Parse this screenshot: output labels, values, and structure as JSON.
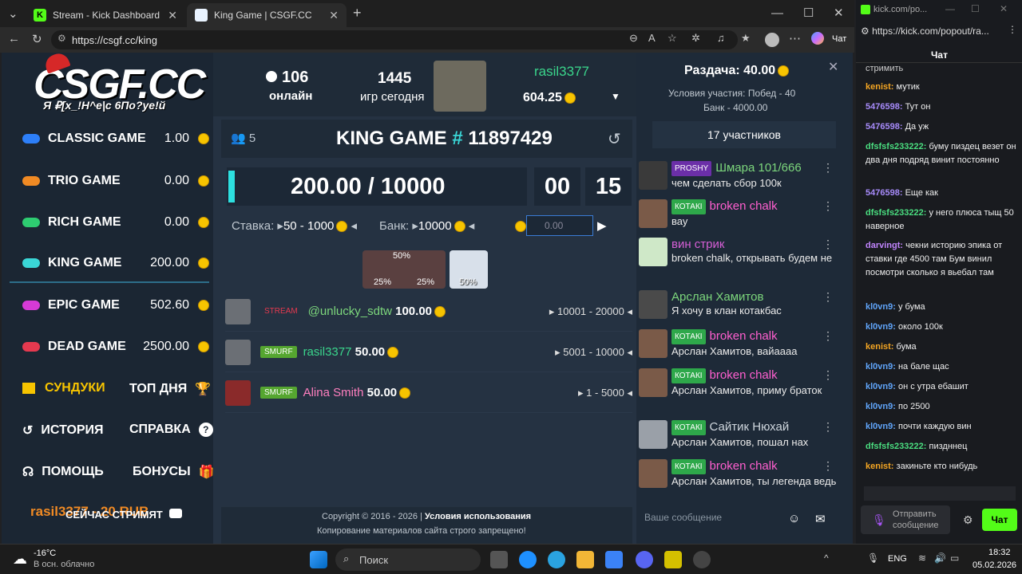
{
  "tabs": [
    {
      "label": "Stream - Kick Dashboard"
    },
    {
      "label": "King Game | CSGF.CC"
    }
  ],
  "url": "https://csgf.cc/king",
  "copilot_label": "Чат",
  "site": {
    "logo": "CSGF.CC",
    "logo_sub": "Я ₽[x_!H^e|c 6По?уе!й",
    "online_count": "106",
    "online_label": "онлайн",
    "games_today_count": "1445",
    "games_today_label": "игр сегодня",
    "user_name": "rasil3377",
    "user_balance": "604.25",
    "giveaway_label": "Раздача:",
    "giveaway_value": "40.00",
    "giveaway_cond": "Условия участия: Побед - 40",
    "giveaway_bank": "Банк - 4000.00",
    "participants": "17 участников",
    "games": [
      {
        "name": "CLASSIC GAME",
        "value": "1.00",
        "color": "#2d7ff9"
      },
      {
        "name": "TRIO GAME",
        "value": "0.00",
        "color": "#f08a24"
      },
      {
        "name": "RICH GAME",
        "value": "0.00",
        "color": "#2ecc71"
      },
      {
        "name": "KING GAME",
        "value": "200.00",
        "color": "#3ad6d6"
      },
      {
        "name": "EPIC GAME",
        "value": "502.60",
        "color": "#d63ad6"
      },
      {
        "name": "DEAD GAME",
        "value": "2500.00",
        "color": "#e5394f"
      }
    ],
    "chests": "СУНДУКИ",
    "top_day": "ТОП ДНЯ",
    "history": "ИСТОРИЯ",
    "help_ref": "СПРАВКА",
    "support": "ПОМОЩЬ",
    "bonuses": "БОНУСЫ",
    "promo": "rasil3377 - 20 RUB",
    "stream_now": "СЕЙЧАС СТРИМЯТ",
    "player_count": "5",
    "king_title": "KING GAME",
    "king_hash": "#",
    "king_number": "11897429",
    "bank_progress": "200.00 / 10000",
    "timer_min": "00",
    "timer_sec": "15",
    "bet_label": "Ставка:",
    "bet_range": "50 - 1000",
    "bank_label": "Банк:",
    "bank_value": "10000",
    "bet_input": "0.00",
    "chances": [
      {
        "pct": "25%"
      },
      {
        "pct": "50%"
      },
      {
        "pct": "25%"
      },
      {
        "pct": "50%"
      }
    ],
    "bets": [
      {
        "badge": "STREAM",
        "name": "@unlucky_sdtw",
        "amount": "100.00",
        "range": "10001 - 20000"
      },
      {
        "badge": "SMURF",
        "name": "rasil3377",
        "amount": "50.00",
        "range": "5001 - 10000"
      },
      {
        "badge": "SMURF",
        "name": "Alina Smith",
        "amount": "50.00",
        "range": "1 - 5000"
      }
    ],
    "copyright": "Copyright © 2016 - 2026",
    "terms": "Условия использования",
    "copy_notice": "Копирование материалов сайта строго запрещено!",
    "chat_placeholder": "Ваше сообщение",
    "chat": [
      {
        "badge": "PROSHY",
        "nick": "Шмара 101/666",
        "text": "чем сделать сбор 100к",
        "color": "#7cd67c"
      },
      {
        "badge": "КОТАКI",
        "nick": "broken chalk",
        "text": "вау",
        "color": "#ff5fd0"
      },
      {
        "badge": "",
        "nick": "вин стрик",
        "text": "broken chalk, открывать будем не",
        "color": "#d65fd6"
      },
      {
        "badge": "",
        "nick": "Арслан Хамитов",
        "text": "Я хочу в клан котакбас",
        "color": "#7cd67c"
      },
      {
        "badge": "КОТАКI",
        "nick": "broken chalk",
        "text": "Арслан Хамитов, вайаааа",
        "color": "#ff5fd0"
      },
      {
        "badge": "КОТАКI",
        "nick": "broken chalk",
        "text": "Арслан Хамитов, приму браток",
        "color": "#ff5fd0"
      },
      {
        "badge": "КОТАКI",
        "nick": "Сайтик Нюхай",
        "text": "Арслан Хамитов, пошал нах",
        "color": "#cfd6dd"
      },
      {
        "badge": "КОТАКI",
        "nick": "broken chalk",
        "text": "Арслан Хамитов, ты легенда ведь",
        "color": "#ff5fd0"
      }
    ]
  },
  "popout": {
    "url_short": "kick.com/po...",
    "url": "https://kick.com/popout/ra...",
    "title": "Чат",
    "messages": [
      {
        "nick": "",
        "text": "стримить",
        "color": "#fff"
      },
      {
        "nick": "kenist:",
        "text": "мутик",
        "color": "#f5a623"
      },
      {
        "nick": "5476598:",
        "text": "Тут он",
        "color": "#a78bfa"
      },
      {
        "nick": "5476598:",
        "text": "Да уж",
        "color": "#a78bfa"
      },
      {
        "nick": "dfsfsfs233222:",
        "text": "буму пиздец везет он два дня подряд винит постоянно",
        "color": "#4ade80"
      },
      {
        "nick": "5476598:",
        "text": "Еще как",
        "color": "#a78bfa"
      },
      {
        "nick": "dfsfsfs233222:",
        "text": "у него плюса тыщ 50 наверное",
        "color": "#4ade80"
      },
      {
        "nick": "darvingt:",
        "text": "чекни историю эпика от ставки где 4500 там Бум винил посмотри сколько я вьебал там",
        "color": "#c084fc"
      },
      {
        "nick": "kl0vn9:",
        "text": "у бума",
        "color": "#60a5fa"
      },
      {
        "nick": "kl0vn9:",
        "text": "около 100к",
        "color": "#60a5fa"
      },
      {
        "nick": "kenist:",
        "text": "бума",
        "color": "#f5a623"
      },
      {
        "nick": "kl0vn9:",
        "text": "на бале щас",
        "color": "#60a5fa"
      },
      {
        "nick": "kl0vn9:",
        "text": "он с утра ебашит",
        "color": "#60a5fa"
      },
      {
        "nick": "kl0vn9:",
        "text": "по 2500",
        "color": "#60a5fa"
      },
      {
        "nick": "kl0vn9:",
        "text": "почти каждую вин",
        "color": "#60a5fa"
      },
      {
        "nick": "dfsfsfs233222:",
        "text": "пиздннец",
        "color": "#4ade80"
      },
      {
        "nick": "kenist:",
        "text": "закиньте кто нибудь",
        "color": "#f5a623"
      }
    ],
    "send_placeholder": "Отправить сообщение",
    "chat_button": "Чат"
  },
  "taskbar": {
    "temp": "-16°C",
    "weather": "В осн. облачно",
    "search": "Поиск",
    "lang": "ENG",
    "time": "18:32",
    "date": "05.02.2026"
  }
}
